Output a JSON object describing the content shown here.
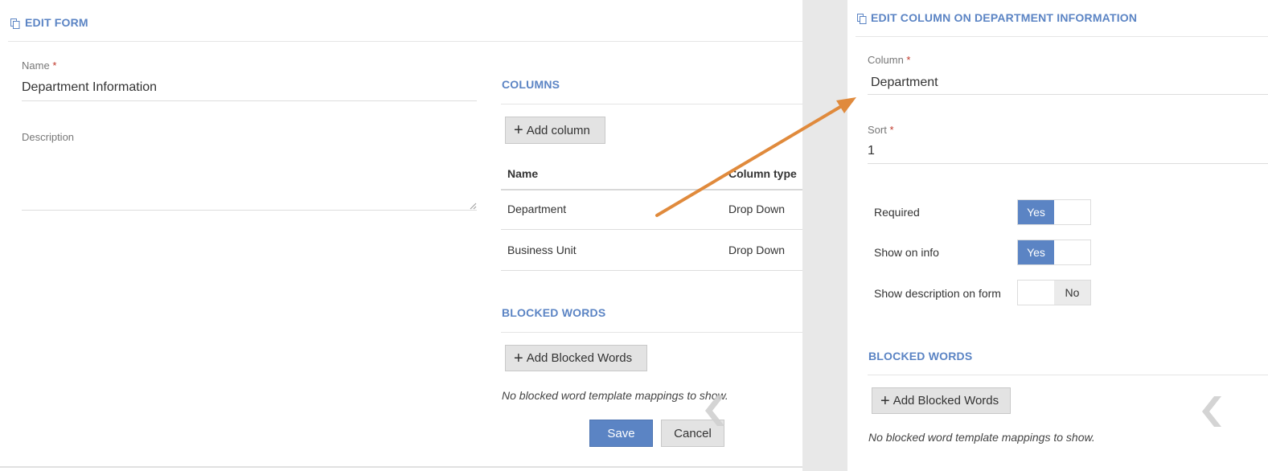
{
  "edit_form": {
    "title": "EDIT FORM",
    "name_label": "Name",
    "name_value": "Department Information",
    "description_label": "Description",
    "columns_title": "COLUMNS",
    "add_column_label": "Add column",
    "table_headers": [
      "Name",
      "Column type"
    ],
    "rows": [
      {
        "name": "Department",
        "type": "Drop Down"
      },
      {
        "name": "Business Unit",
        "type": "Drop Down"
      }
    ],
    "blocked_title": "BLOCKED WORDS",
    "add_blocked_label": "Add Blocked Words",
    "blocked_empty": "No blocked word template mappings to show.",
    "save_label": "Save",
    "cancel_label": "Cancel"
  },
  "edit_column": {
    "title": "EDIT COLUMN ON DEPARTMENT INFORMATION",
    "column_label": "Column",
    "column_value": "Department",
    "sort_label": "Sort",
    "sort_value": "1",
    "required_label": "Required",
    "required_value": "Yes",
    "show_info_label": "Show on info",
    "show_info_value": "Yes",
    "show_desc_label": "Show description on form",
    "show_desc_value": "No",
    "blocked_title": "BLOCKED WORDS",
    "add_blocked_label": "Add Blocked Words",
    "blocked_empty": "No blocked word template mappings to show."
  },
  "required_marker": "*",
  "colors": {
    "accent": "#5b84c4",
    "arrow": "#e08a3c",
    "required": "#c0392b"
  },
  "icons": [
    "copy-icon",
    "plus-icon",
    "resize-grip-icon",
    "chevron-left-icon",
    "arrow-annotation"
  ]
}
